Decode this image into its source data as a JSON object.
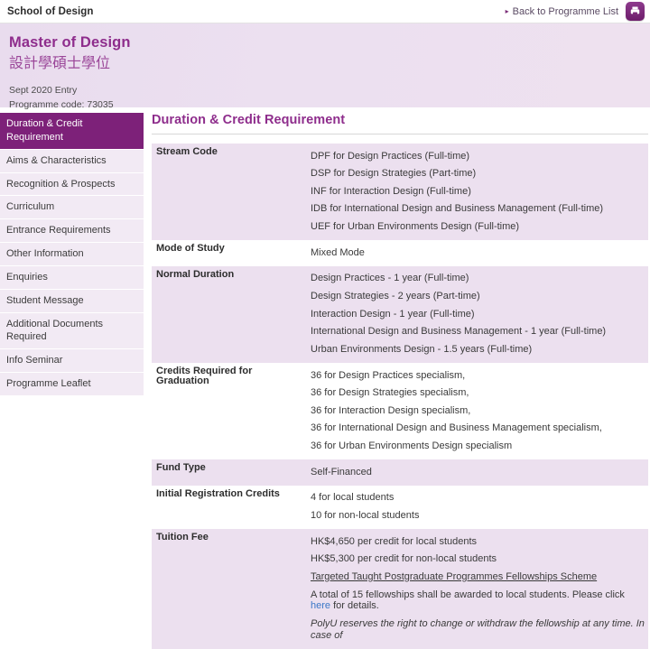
{
  "topbar": {
    "school_name": "School of Design",
    "back_link": "Back to Programme List",
    "back_arrow_glyph": "▸",
    "print_icon": "printer-icon"
  },
  "banner": {
    "title_en": "Master of Design",
    "title_zh": "設計學碩士學位",
    "entry": "Sept 2020 Entry",
    "programme_code": "Programme code: 73035"
  },
  "sidebar": {
    "items": [
      {
        "label": "Duration & Credit Requirement",
        "active": true
      },
      {
        "label": "Aims & Characteristics",
        "active": false
      },
      {
        "label": "Recognition & Prospects",
        "active": false
      },
      {
        "label": "Curriculum",
        "active": false
      },
      {
        "label": "Entrance Requirements",
        "active": false
      },
      {
        "label": "Other Information",
        "active": false
      },
      {
        "label": "Enquiries",
        "active": false
      },
      {
        "label": "Student Message",
        "active": false
      },
      {
        "label": "Additional Documents Required",
        "active": false
      },
      {
        "label": "Info Seminar",
        "active": false
      },
      {
        "label": "Programme Leaflet",
        "active": false
      }
    ]
  },
  "main": {
    "section_title": "Duration & Credit Requirement",
    "rows": [
      {
        "label": "Stream Code",
        "shaded": true,
        "lines": [
          {
            "text": "DPF for Design Practices (Full-time)"
          },
          {
            "text": "DSP for Design Strategies (Part-time)"
          },
          {
            "text": "INF for Interaction Design (Full-time)"
          },
          {
            "text": "IDB for International Design and Business Management (Full-time)"
          },
          {
            "text": "UEF for Urban Environments Design (Full-time)"
          }
        ]
      },
      {
        "label": "Mode of Study",
        "shaded": false,
        "lines": [
          {
            "text": "Mixed Mode"
          }
        ]
      },
      {
        "label": "Normal Duration",
        "shaded": true,
        "lines": [
          {
            "text": "Design Practices - 1 year (Full-time)"
          },
          {
            "text": "Design Strategies - 2 years (Part-time)"
          },
          {
            "text": "Interaction Design - 1 year (Full-time)"
          },
          {
            "text": "International Design and Business Management - 1 year (Full-time)"
          },
          {
            "text": "Urban Environments Design - 1.5 years (Full-time)"
          }
        ]
      },
      {
        "label": "Credits Required for Graduation",
        "shaded": false,
        "lines": [
          {
            "text": "36 for Design Practices specialism,"
          },
          {
            "text": "36 for Design Strategies specialism,"
          },
          {
            "text": "36 for Interaction Design specialism,"
          },
          {
            "text": "36 for International Design and Business Management specialism,"
          },
          {
            "text": "36 for Urban Environments Design specialism"
          }
        ]
      },
      {
        "label": "Fund Type",
        "shaded": true,
        "lines": [
          {
            "text": "Self-Financed"
          }
        ]
      },
      {
        "label": "Initial Registration Credits",
        "shaded": false,
        "lines": [
          {
            "text": "4 for local students"
          },
          {
            "text": "10 for non-local students"
          }
        ]
      },
      {
        "label": "Tuition Fee",
        "shaded": true,
        "lines": [
          {
            "text": "HK$4,650 per credit for local students"
          },
          {
            "text": "HK$5,300 per credit for non-local students"
          },
          {
            "text": "Targeted Taught Postgraduate Programmes Fellowships Scheme",
            "style": "underline"
          },
          {
            "text": "A total of 15 fellowships shall be awarded to local students. Please click ",
            "link_text": "here",
            "text_after": " for details."
          },
          {
            "text": "PolyU reserves the right to change or withdraw the fellowship at any time. In case of",
            "style": "italic"
          }
        ]
      }
    ]
  },
  "colors": {
    "brand_purple": "#7d2179",
    "title_purple": "#8e2d8c",
    "row_shade": "#ece0ef",
    "sidebar_bg": "#f2eaf4",
    "link_blue": "#3b77c7"
  }
}
